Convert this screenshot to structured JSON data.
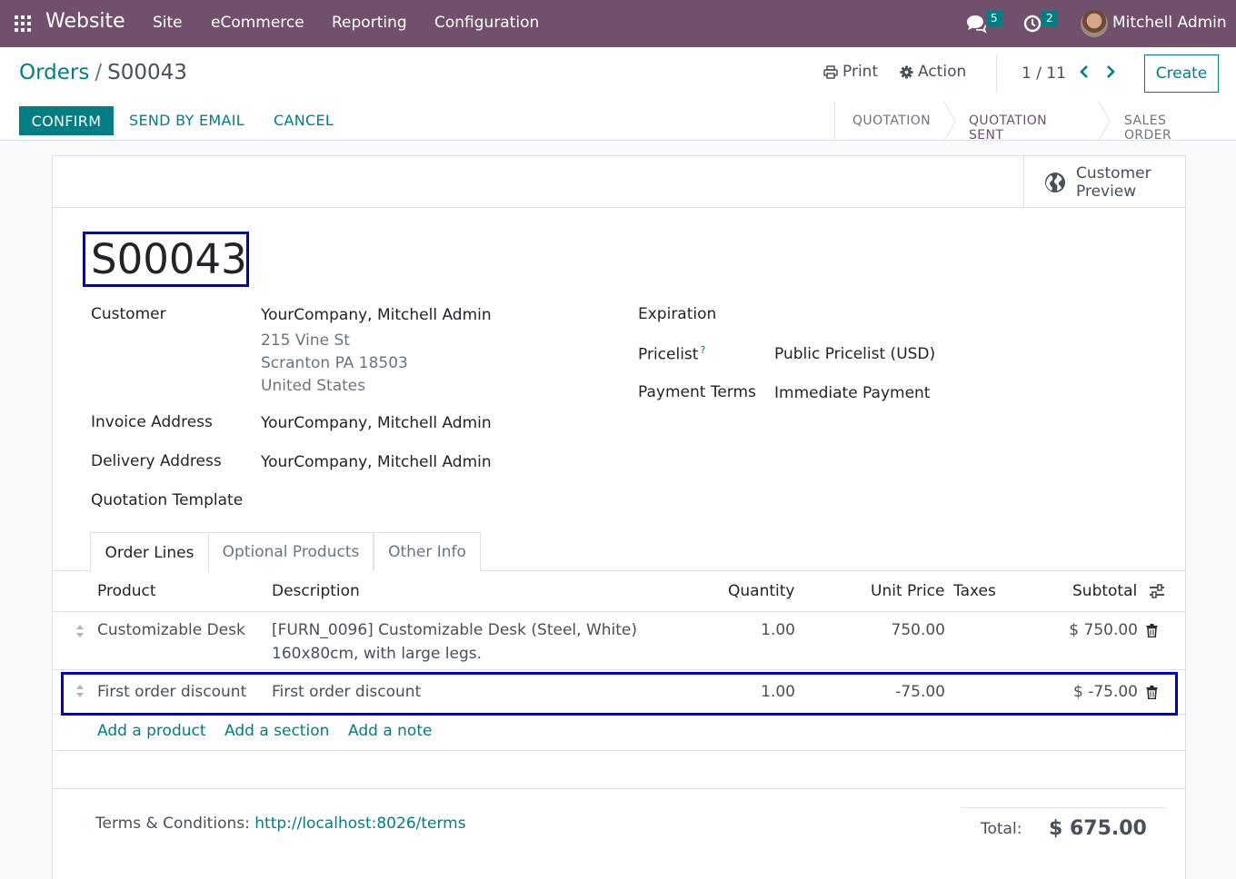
{
  "navbar": {
    "brand": "Website",
    "menus": [
      "Site",
      "eCommerce",
      "Reporting",
      "Configuration"
    ],
    "messages_count": "5",
    "activities_count": "2",
    "user_name": "Mitchell Admin"
  },
  "control_panel": {
    "breadcrumb_parent": "Orders",
    "breadcrumb_separator": "/",
    "breadcrumb_current": "S00043",
    "print_label": "Print",
    "action_label": "Action",
    "pager_value": "1 / 11",
    "create_label": "Create",
    "confirm_label": "CONFIRM",
    "send_email_label": "SEND BY EMAIL",
    "cancel_label": "CANCEL",
    "statuses": [
      "QUOTATION",
      "QUOTATION SENT",
      "SALES ORDER"
    ],
    "active_status": "QUOTATION SENT"
  },
  "form": {
    "customer_preview_line1": "Customer",
    "customer_preview_line2": "Preview",
    "title": "S00043",
    "customer_label": "Customer",
    "customer_name": "YourCompany, Mitchell Admin",
    "customer_street": "215 Vine St",
    "customer_city": "Scranton PA 18503",
    "customer_country": "United States",
    "invoice_address_label": "Invoice Address",
    "invoice_address": "YourCompany, Mitchell Admin",
    "delivery_address_label": "Delivery Address",
    "delivery_address": "YourCompany, Mitchell Admin",
    "quotation_template_label": "Quotation Template",
    "quotation_template": "",
    "expiration_label": "Expiration",
    "expiration": "",
    "pricelist_label": "Pricelist",
    "pricelist_help": "?",
    "pricelist": "Public Pricelist (USD)",
    "payment_terms_label": "Payment Terms",
    "payment_terms": "Immediate Payment"
  },
  "tabs": [
    "Order Lines",
    "Optional Products",
    "Other Info"
  ],
  "order_lines": {
    "columns": {
      "product": "Product",
      "description": "Description",
      "quantity": "Quantity",
      "unit_price": "Unit Price",
      "taxes": "Taxes",
      "subtotal": "Subtotal"
    },
    "rows": [
      {
        "product": "Customizable Desk",
        "description_line1": "[FURN_0096] Customizable Desk (Steel, White)",
        "description_line2": "160x80cm, with large legs.",
        "quantity": "1.00",
        "unit_price": "750.00",
        "taxes": "",
        "subtotal": "$ 750.00"
      },
      {
        "product": "First order discount",
        "description_line1": "First order discount",
        "quantity": "1.00",
        "unit_price": "-75.00",
        "taxes": "",
        "subtotal": "$ -75.00"
      }
    ],
    "add_product": "Add a product",
    "add_section": "Add a section",
    "add_note": "Add a note"
  },
  "footer": {
    "terms_label": "Terms & Conditions:",
    "terms_url": "http://localhost:8026/terms",
    "total_label": "Total:",
    "total_value": "$ 675.00"
  },
  "colors": {
    "navbar": "#71506b",
    "primary": "#017e84",
    "highlight_box": "#0000cc"
  }
}
